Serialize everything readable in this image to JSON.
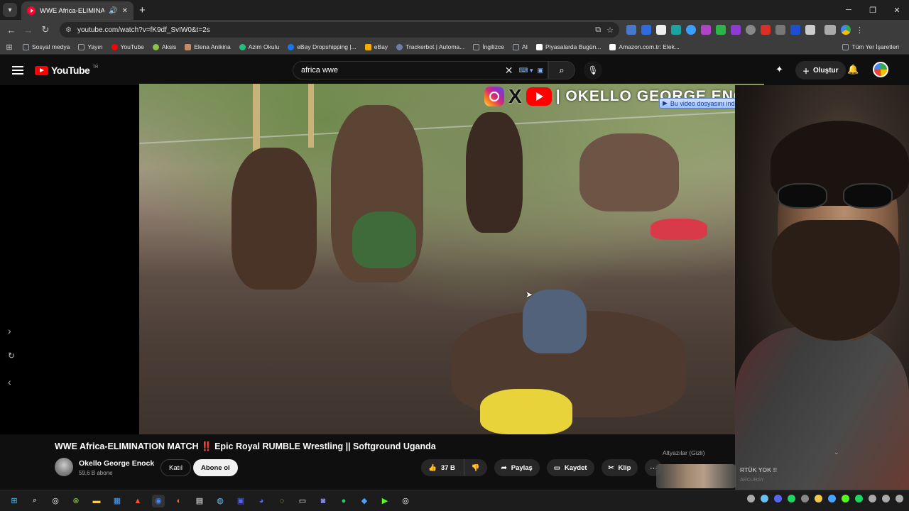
{
  "browser": {
    "tab": {
      "title": "WWE Africa-ELIMINATION M",
      "audio_icon": "speaker-icon",
      "close_icon": "close-icon"
    },
    "url": "youtube.com/watch?v=fK9df_SvIW0&t=2s",
    "bookmarks": [
      {
        "label": "Sosyal medya",
        "icon": "folder-icon",
        "color": "#9aa0a6"
      },
      {
        "label": "Yayın",
        "icon": "folder-icon",
        "color": "#9aa0a6"
      },
      {
        "label": "YouTube",
        "icon": "youtube-icon",
        "color": "#ff0000"
      },
      {
        "label": "Aksis",
        "icon": "aksis-icon",
        "color": "#8bc34a"
      },
      {
        "label": "Elena Anikina",
        "icon": "profile-icon",
        "color": "#c48b6a"
      },
      {
        "label": "Azim Okulu",
        "icon": "azim-icon",
        "color": "#21c07a"
      },
      {
        "label": "eBay Dropshipping |...",
        "icon": "facebook-icon",
        "color": "#1877f2"
      },
      {
        "label": "eBay",
        "icon": "ebay-icon",
        "color": "#f5af02"
      },
      {
        "label": "Trackerbot | Automa...",
        "icon": "tracker-icon",
        "color": "#6d7ea8"
      },
      {
        "label": "İngilizce",
        "icon": "folder-icon",
        "color": "#9aa0a6"
      },
      {
        "label": "AI",
        "icon": "folder-icon",
        "color": "#9aa0a6"
      },
      {
        "label": "Piyasalarda Bugün...",
        "icon": "tradingview-icon",
        "color": "#ffffff"
      },
      {
        "label": "Amazon.com.tr: Elek...",
        "icon": "amazon-icon",
        "color": "#ffffff"
      }
    ],
    "all_bookmarks": "Tüm Yer İşaretleri"
  },
  "youtube": {
    "logo_text": "YouTube",
    "country_code": "TR",
    "search_query": "africa wwe",
    "create_label": "Oluştur"
  },
  "video": {
    "watermark_text": "| OKELLO GEORGE ENOCK",
    "download_badge": "Bu video dosyasını indir",
    "download_ctrl_a": "?",
    "download_ctrl_b": "X"
  },
  "details": {
    "title_part1": "WWE Africa-ELIMINATION MATCH",
    "title_bang": "‼️",
    "title_part2": "Epic Royal RUMBLE Wrestling || Softground Uganda",
    "channel_name": "Okello George Enock",
    "subscribers": "59,6 B abone",
    "join_label": "Katıl",
    "subscribe_label": "Abone ol",
    "likes": "37 B",
    "share_label": "Paylaş",
    "save_label": "Kaydet",
    "clip_label": "Klip",
    "more_label": "⋯"
  },
  "sidebar_overlay": {
    "captions_label": "Altyazılar (Gizli)",
    "rec_title": "RTÜK YOK !!",
    "rec_channel": "ARCURAY"
  },
  "colors": {
    "brand_red": "#ff0000",
    "background": "#0f0f0f",
    "accent_blue": "#3ea6ff"
  }
}
